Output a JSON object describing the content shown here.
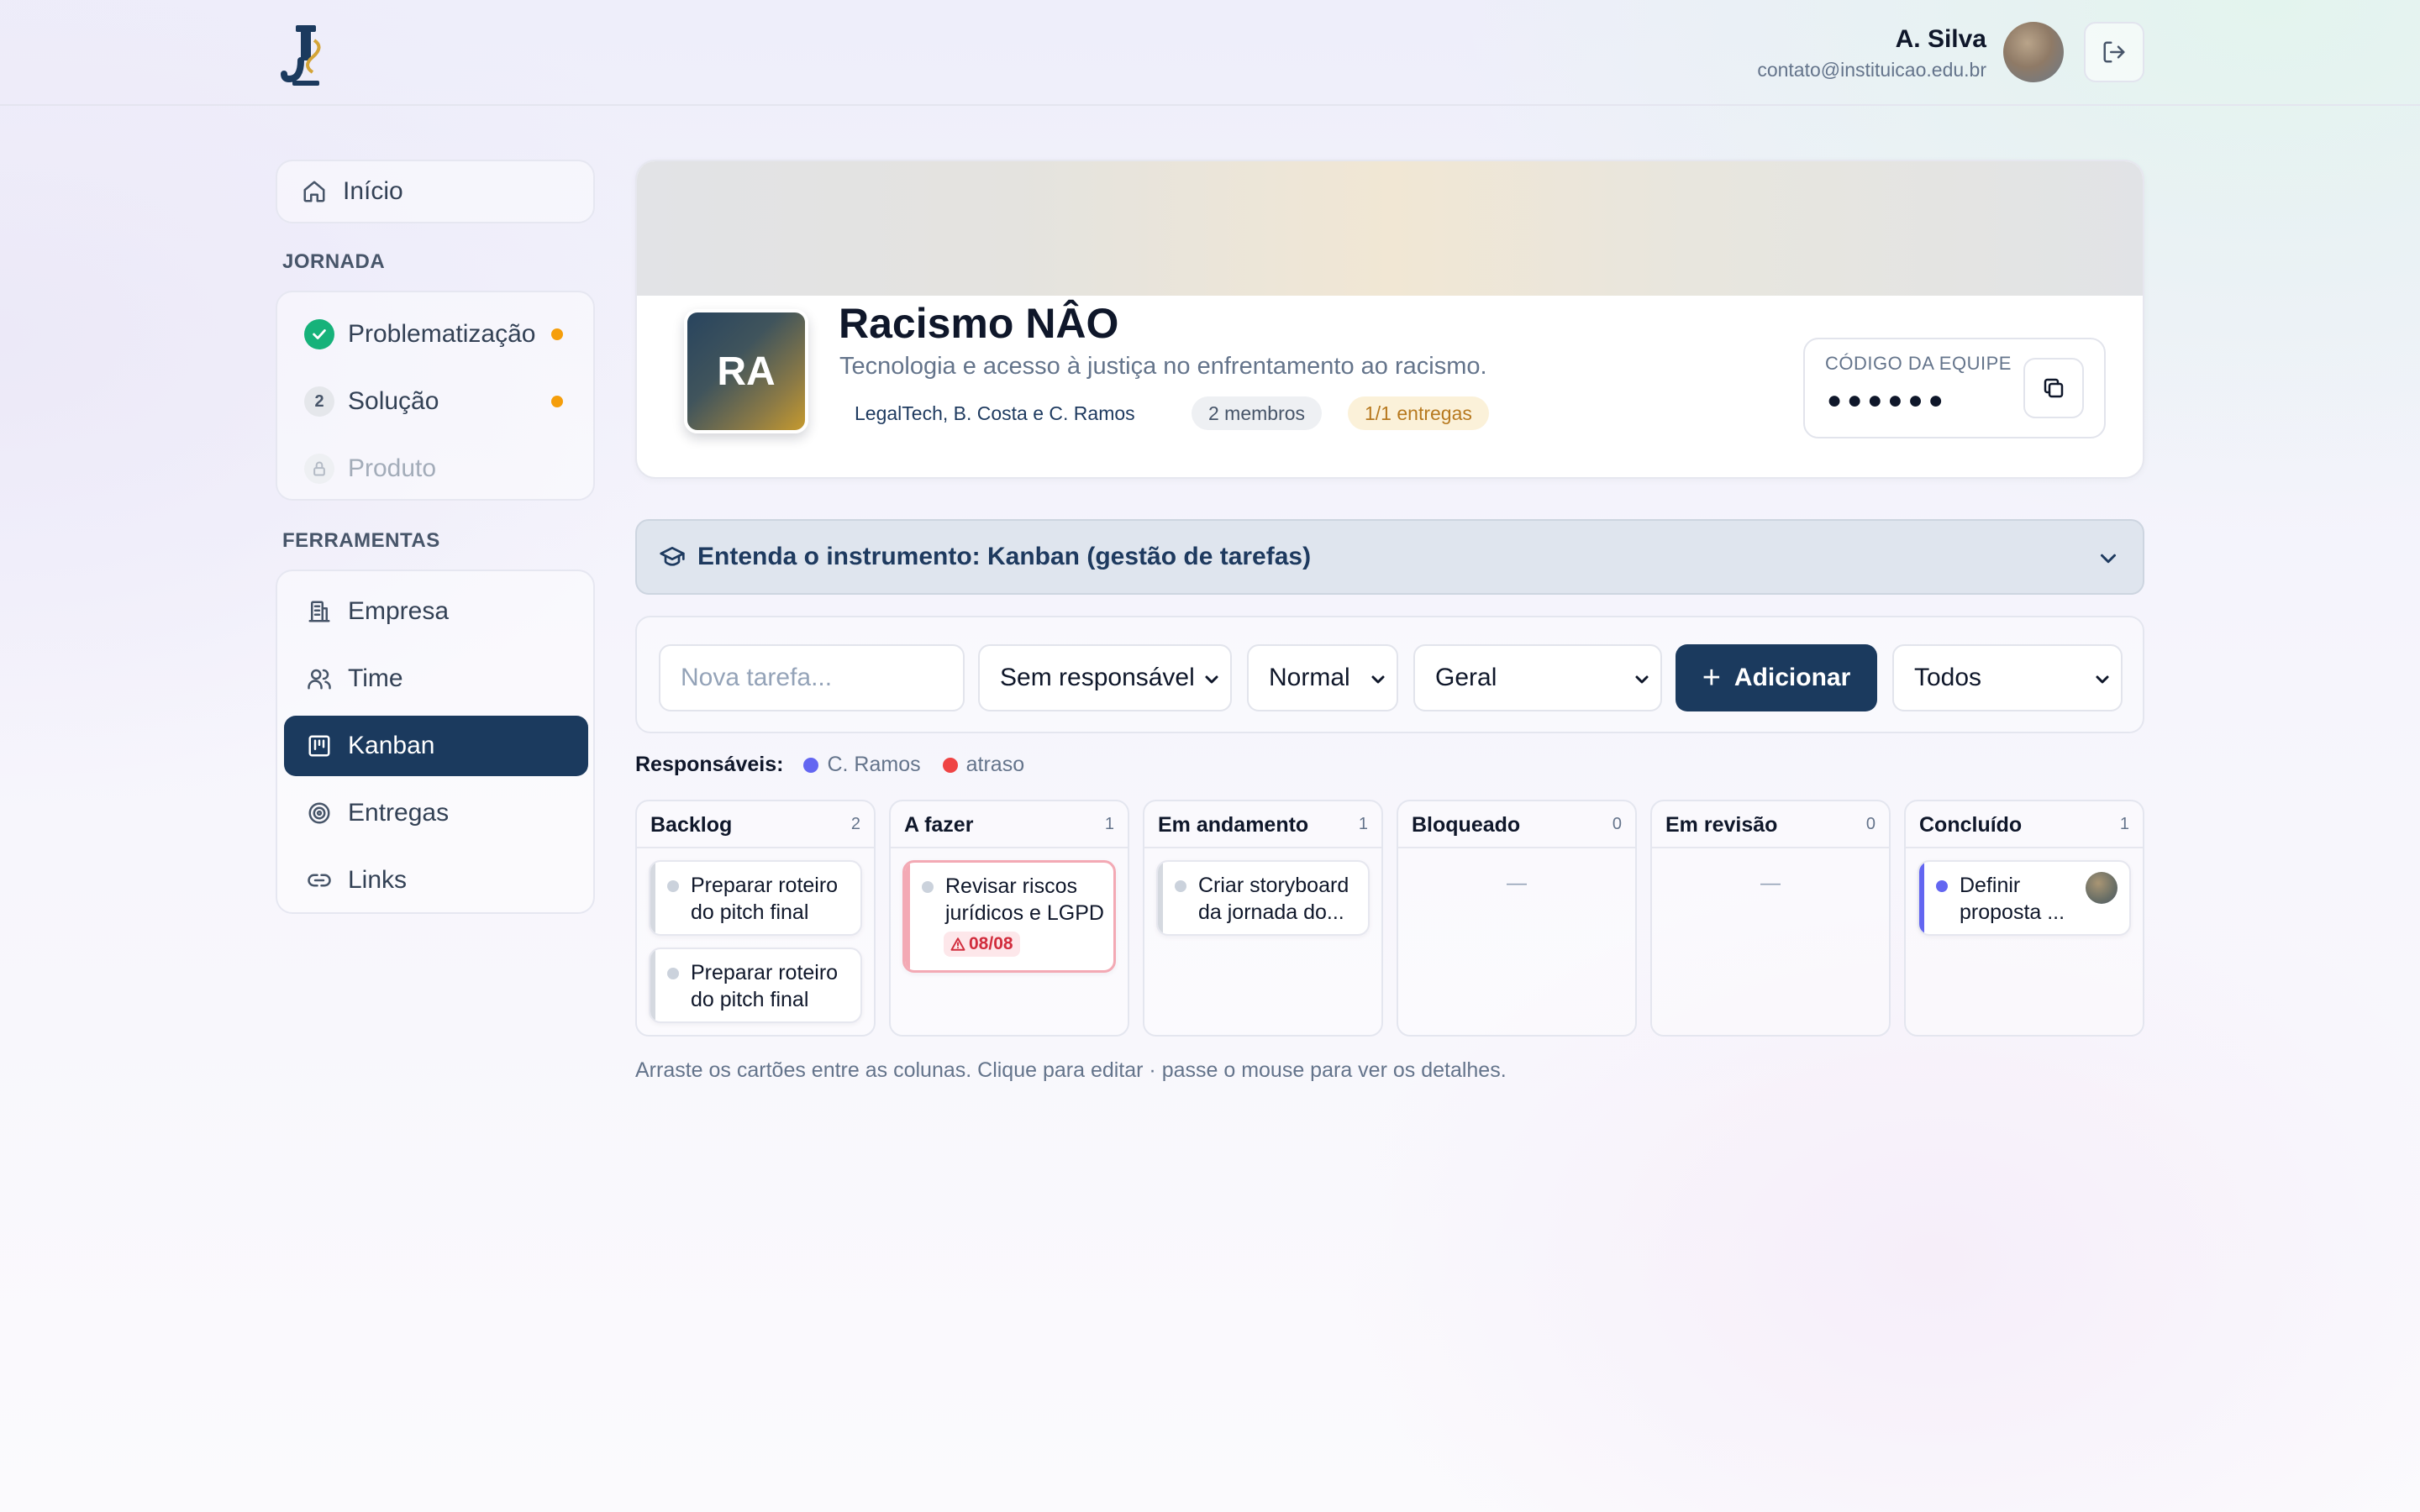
{
  "header": {
    "user_name": "A. Silva",
    "user_email": "contato@instituicao.edu.br"
  },
  "sidebar": {
    "home": "Início",
    "journey_heading": "JORNADA",
    "journey": [
      {
        "label": "Problematização",
        "state": "done",
        "dot": true
      },
      {
        "label": "Solução",
        "step": "2",
        "dot": true
      },
      {
        "label": "Produto",
        "state": "locked"
      }
    ],
    "tools_heading": "FERRAMENTAS",
    "tools": [
      {
        "label": "Empresa",
        "icon": "building-icon"
      },
      {
        "label": "Time",
        "icon": "users-icon"
      },
      {
        "label": "Kanban",
        "icon": "kanban-icon",
        "active": true
      },
      {
        "label": "Entregas",
        "icon": "target-icon"
      },
      {
        "label": "Links",
        "icon": "link-icon"
      }
    ]
  },
  "project": {
    "initials": "RA",
    "title": "Racismo NÂO",
    "subtitle": "Tecnologia e acesso à justiça no enfrentamento ao racismo.",
    "team": "LegalTech, B. Costa e C. Ramos",
    "members": "2 membros",
    "deliveries": "1/1 entregas",
    "code_label": "CÓDIGO DA EQUIPE",
    "code_masked": "●●●●●●"
  },
  "instrument": {
    "label": "Entenda o instrumento: Kanban (gestão de tarefas)"
  },
  "task_form": {
    "placeholder": "Nova tarefa...",
    "assignee": "Sem responsável",
    "priority": "Normal",
    "category": "Geral",
    "add_label": "Adicionar",
    "filter": "Todos"
  },
  "legend": {
    "label": "Responsáveis:",
    "items": [
      {
        "name": "C. Ramos",
        "color": "#6366f1"
      },
      {
        "name": "atraso",
        "color": "#ef4444"
      }
    ]
  },
  "columns": [
    {
      "title": "Backlog",
      "count": "2",
      "cards": [
        {
          "text": "Preparar roteiro do pitch final"
        },
        {
          "text": "Preparar roteiro do pitch final"
        }
      ]
    },
    {
      "title": "A fazer",
      "count": "1",
      "cards": [
        {
          "text": "Revisar riscos jurídicos e LGPD",
          "late": "08/08"
        }
      ]
    },
    {
      "title": "Em andamento",
      "count": "1",
      "cards": [
        {
          "text": "Criar storyboard da jornada do..."
        }
      ]
    },
    {
      "title": "Bloqueado",
      "count": "0",
      "empty": "—"
    },
    {
      "title": "Em revisão",
      "count": "0",
      "empty": "—"
    },
    {
      "title": "Concluído",
      "count": "1",
      "cards": [
        {
          "text": "Definir proposta ...",
          "assignee_color": "#6366f1"
        }
      ]
    }
  ],
  "hint": "Arraste os cartões entre as colunas. Clique para editar · passe o mouse para ver os detalhes."
}
